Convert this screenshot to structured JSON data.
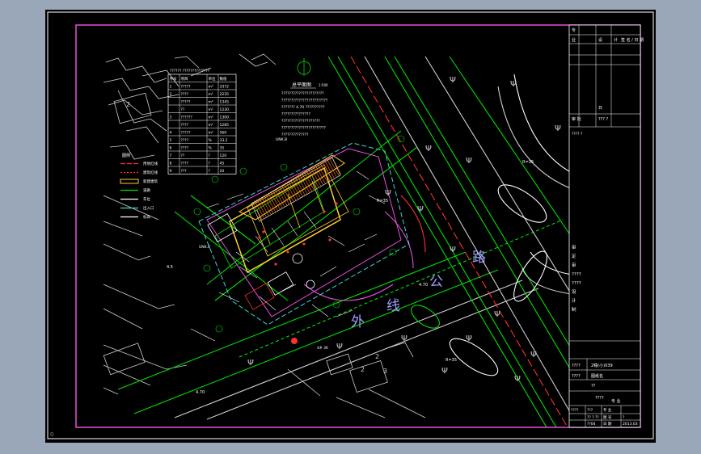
{
  "drawing": {
    "road_name": [
      "外",
      "线",
      "公",
      "路"
    ],
    "road_level": "4.70",
    "level_left": "4.5",
    "level_bottom": "4.70",
    "building_label": "4# 36",
    "unit_labels": [
      "UNK.B",
      "UNK.B"
    ],
    "radius_labels": [
      "R=35",
      "R=35",
      "R=35"
    ],
    "plan_title": "总平面图",
    "plan_scale": "1:500",
    "lot_numbers": [
      "2",
      "2",
      "2",
      "3"
    ],
    "notes_lines": [
      "??????????????????????",
      "????????????????????????",
      "??????? 4.70 ??????????",
      "???????????????",
      "????????????????????",
      "???????????????????????",
      "??????????????"
    ],
    "data_table": {
      "title": "?????? ??????????????",
      "headers": [
        "序号",
        "项目",
        "单位",
        "数值"
      ],
      "rows": [
        [
          "1",
          "?????",
          "m²",
          "3372"
        ],
        [
          "2",
          "????",
          "m²",
          "2235"
        ],
        [
          "",
          "?????",
          "m²",
          "1345"
        ],
        [
          "",
          "??",
          "m²",
          "1230"
        ],
        [
          "3",
          "??????",
          "m²",
          "1300"
        ],
        [
          "",
          "????",
          "m²",
          "1285"
        ],
        [
          "4",
          "?????",
          "m²",
          "560"
        ],
        [
          "5",
          "????",
          "%",
          "33.2"
        ],
        [
          "6",
          "????",
          "%",
          "35"
        ],
        [
          "7",
          "??",
          "?",
          "120"
        ],
        [
          "8",
          "????",
          "?",
          "45"
        ],
        [
          "9",
          "???",
          "?",
          "20"
        ]
      ]
    },
    "legend": {
      "title": "图例",
      "items": [
        {
          "label": "用地红线"
        },
        {
          "label": "建筑红线"
        },
        {
          "label": "新建建筑"
        },
        {
          "label": "道路"
        },
        {
          "label": "车位"
        },
        {
          "label": "出入口"
        },
        {
          "label": "标高"
        }
      ]
    }
  },
  "title_block": {
    "top_rows": [
      [
        "专",
        ""
      ],
      [
        "业",
        "",
        "设",
        "计",
        "签 名 / 日 期"
      ],
      [
        "",
        ""
      ],
      [
        "",
        ""
      ],
      [
        "",
        "",
        "日"
      ],
      [
        "审 批",
        "",
        "??? ?"
      ]
    ],
    "note": "???? ?",
    "project_rows": [
      {
        "label": "审"
      },
      {
        "label": "定"
      },
      {
        "label": "审"
      },
      {
        "label": "????"
      },
      {
        "label": "????"
      },
      {
        "label": "设"
      },
      {
        "label": "计"
      },
      {
        "label": "制"
      }
    ],
    "lower": {
      "row1_left": "????",
      "row1_right": "2幢(小)039",
      "row2_left": "????",
      "row2_right": "图纸名",
      "row3": "??",
      "center": "????",
      "drawing_type": "专 业",
      "bottom_rows": [
        [
          "????",
          "???",
          "专 业",
          ""
        ],
        [
          "",
          "?? ? ??",
          "图 号",
          "?"
        ],
        [
          "",
          "??04",
          "日 期",
          "2013.03"
        ]
      ]
    }
  },
  "colors": {
    "background": "#000000",
    "frame": "#e84fe0",
    "road": "#00e000",
    "building": "#ffcc33",
    "text": "#ffffff",
    "red": "#ff3030",
    "cyan": "#3fd6d6"
  }
}
